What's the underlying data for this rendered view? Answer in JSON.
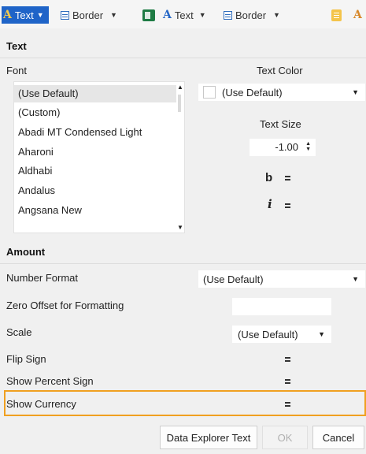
{
  "toolbar": {
    "items": [
      {
        "label": "Text",
        "icon": "text-color-icon"
      },
      {
        "label": "Border",
        "icon": "border-icon"
      },
      {
        "label": "",
        "icon": "excel-icon"
      },
      {
        "label": "Text",
        "icon": "text-style-icon"
      },
      {
        "label": "Border",
        "icon": "border-icon"
      },
      {
        "label": "",
        "icon": "document-icon"
      },
      {
        "label": "",
        "icon": "text-color-icon"
      }
    ]
  },
  "text_section": {
    "title": "Text",
    "font_label": "Font",
    "fonts": [
      "(Use Default)",
      "(Custom)",
      "Abadi MT Condensed Light",
      "Aharoni",
      "Aldhabi",
      "Andalus",
      "Angsana New"
    ],
    "selected_font": "(Use Default)",
    "text_color_label": "Text Color",
    "text_color_value": "(Use Default)",
    "text_size_label": "Text Size",
    "text_size_value": "-1.00",
    "bold_glyph": "b",
    "italic_glyph": "i"
  },
  "amount_section": {
    "title": "Amount",
    "number_format_label": "Number Format",
    "number_format_value": "(Use Default)",
    "zero_offset_label": "Zero Offset for Formatting",
    "zero_offset_value": "",
    "scale_label": "Scale",
    "scale_value": "(Use Default)",
    "flip_sign_label": "Flip Sign",
    "show_percent_label": "Show Percent Sign",
    "show_currency_label": "Show Currency"
  },
  "buttons": {
    "data_explorer": "Data Explorer Text",
    "ok": "OK",
    "cancel": "Cancel"
  },
  "colors": {
    "highlight": "#f0a020",
    "toolbar_active": "#1f64c8"
  }
}
